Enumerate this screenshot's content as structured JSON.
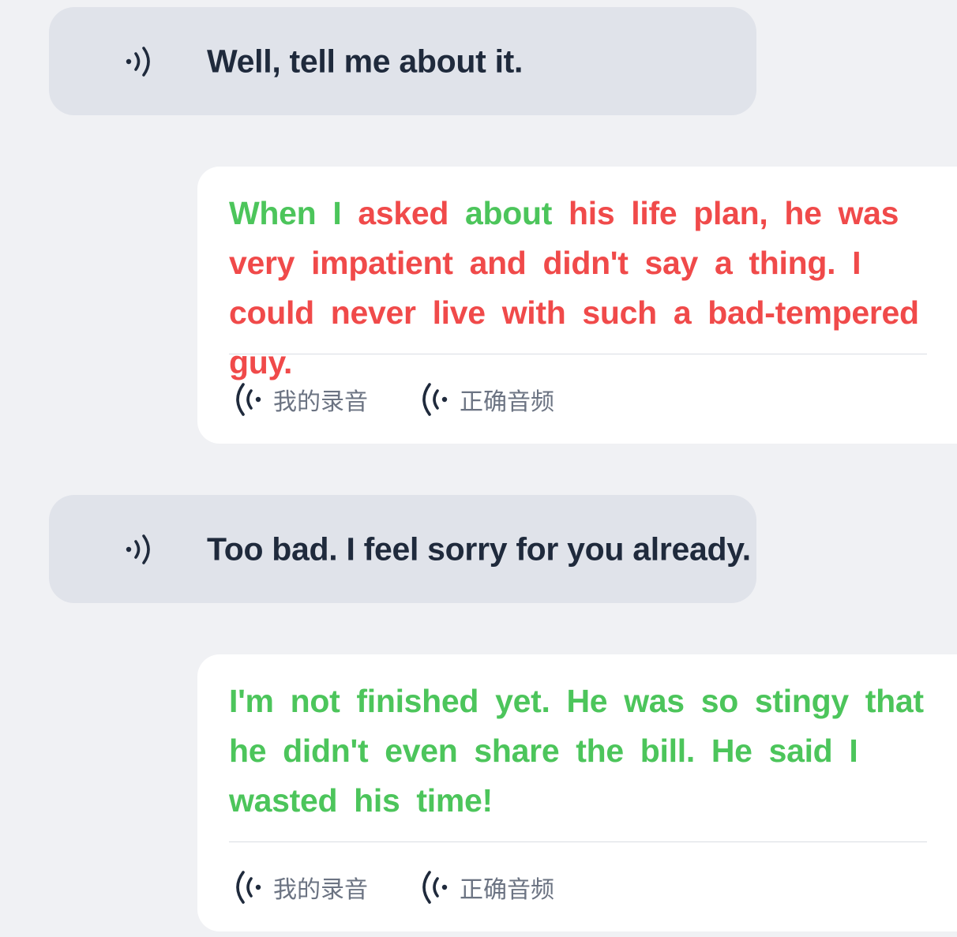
{
  "colors": {
    "page_bg": "#f0f1f4",
    "prompt_bg": "#e0e3ea",
    "answer_bg": "#ffffff",
    "text_dark": "#1f2a3c",
    "correct": "#4cc55b",
    "incorrect": "#f04a4a",
    "label_gray": "#6b7382"
  },
  "dialogue": [
    {
      "prompt": {
        "icon": "speaker-icon",
        "text": "Well, tell me about it."
      },
      "answer": {
        "words": [
          {
            "text": "When",
            "status": "correct"
          },
          {
            "text": "I",
            "status": "correct"
          },
          {
            "text": "asked",
            "status": "incorrect"
          },
          {
            "text": "about",
            "status": "correct"
          },
          {
            "text": "his",
            "status": "incorrect"
          },
          {
            "text": "life",
            "status": "incorrect"
          },
          {
            "text": "plan,",
            "status": "incorrect"
          },
          {
            "text": "he",
            "status": "incorrect"
          },
          {
            "text": "was",
            "status": "incorrect"
          },
          {
            "text": "very",
            "status": "incorrect"
          },
          {
            "text": "impatient",
            "status": "incorrect"
          },
          {
            "text": "and",
            "status": "incorrect"
          },
          {
            "text": "didn't",
            "status": "incorrect"
          },
          {
            "text": "say",
            "status": "incorrect"
          },
          {
            "text": "a",
            "status": "incorrect"
          },
          {
            "text": "thing.",
            "status": "incorrect"
          },
          {
            "text": "I",
            "status": "incorrect"
          },
          {
            "text": "could",
            "status": "incorrect"
          },
          {
            "text": "never",
            "status": "incorrect"
          },
          {
            "text": "live",
            "status": "incorrect"
          },
          {
            "text": "with",
            "status": "incorrect"
          },
          {
            "text": "such",
            "status": "incorrect"
          },
          {
            "text": "a",
            "status": "incorrect"
          },
          {
            "text": "bad-tempered",
            "status": "incorrect"
          },
          {
            "text": "guy.",
            "status": "incorrect"
          }
        ],
        "buttons": [
          {
            "icon": "audio-wave-icon",
            "label": "我的录音"
          },
          {
            "icon": "audio-wave-icon",
            "label": "正确音频"
          }
        ]
      }
    },
    {
      "prompt": {
        "icon": "speaker-icon",
        "text": "Too bad. I feel sorry for you already."
      },
      "answer": {
        "words": [
          {
            "text": "I'm",
            "status": "correct"
          },
          {
            "text": "not",
            "status": "correct"
          },
          {
            "text": "finished",
            "status": "correct"
          },
          {
            "text": "yet.",
            "status": "correct"
          },
          {
            "text": "He",
            "status": "correct"
          },
          {
            "text": "was",
            "status": "correct"
          },
          {
            "text": "so",
            "status": "correct"
          },
          {
            "text": "stingy",
            "status": "correct"
          },
          {
            "text": "that",
            "status": "correct"
          },
          {
            "text": "he",
            "status": "correct"
          },
          {
            "text": "didn't",
            "status": "correct"
          },
          {
            "text": "even",
            "status": "correct"
          },
          {
            "text": "share",
            "status": "correct"
          },
          {
            "text": "the",
            "status": "correct"
          },
          {
            "text": "bill.",
            "status": "correct"
          },
          {
            "text": "He",
            "status": "correct"
          },
          {
            "text": "said",
            "status": "correct"
          },
          {
            "text": "I",
            "status": "correct"
          },
          {
            "text": "wasted",
            "status": "correct"
          },
          {
            "text": "his",
            "status": "correct"
          },
          {
            "text": "time!",
            "status": "correct"
          }
        ],
        "buttons": [
          {
            "icon": "audio-wave-icon",
            "label": "我的录音"
          },
          {
            "icon": "audio-wave-icon",
            "label": "正确音频"
          }
        ]
      }
    }
  ]
}
